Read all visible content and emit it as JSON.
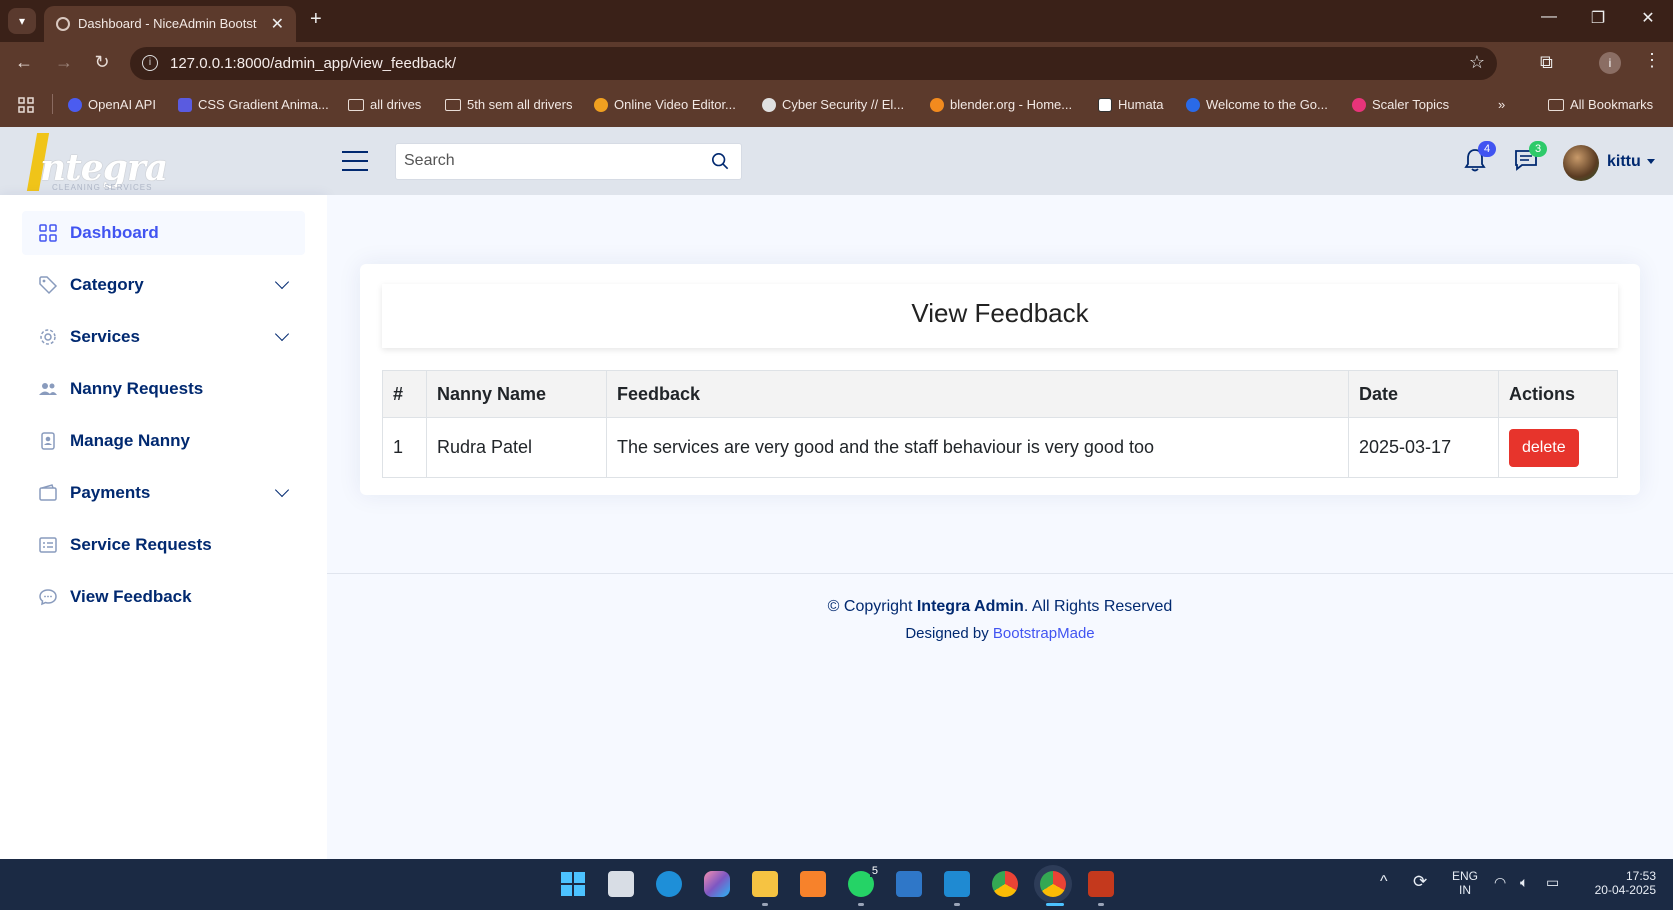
{
  "browser": {
    "tab_title": "Dashboard - NiceAdmin Bootst",
    "url": "127.0.0.1:8000/admin_app/view_feedback/",
    "bookmarks": [
      {
        "label": "OpenAI API",
        "color": "#4b5cf0"
      },
      {
        "label": "CSS Gradient Anima...",
        "color": "#5a5be0"
      },
      {
        "label": "all drives",
        "color": "folder"
      },
      {
        "label": "5th sem all drivers",
        "color": "folder"
      },
      {
        "label": "Online Video Editor...",
        "color": "#f0a020"
      },
      {
        "label": "Cyber Security // El...",
        "color": "#e0e0e0"
      },
      {
        "label": "blender.org - Home...",
        "color": "#f28a1e"
      },
      {
        "label": "Humata",
        "color": "#ffffff"
      },
      {
        "label": "Welcome to the Go...",
        "color": "#2a6ae8"
      },
      {
        "label": "Scaler Topics",
        "color": "#e8347a"
      }
    ],
    "all_bookmarks_label": "All Bookmarks"
  },
  "header": {
    "logo_text": "ntegra",
    "logo_sub": "CLEANING   SERVICES",
    "search_placeholder": "Search",
    "notifications_count": "4",
    "messages_count": "3",
    "user_name": "kittu",
    "colors": {
      "notif_badge": "#4154f1",
      "msg_badge": "#2eca6a"
    }
  },
  "sidebar": {
    "items": [
      {
        "label": "Dashboard",
        "icon": "grid-icon",
        "active": true
      },
      {
        "label": "Category",
        "icon": "tag-icon",
        "expandable": true
      },
      {
        "label": "Services",
        "icon": "gear-icon",
        "expandable": true
      },
      {
        "label": "Nanny Requests",
        "icon": "people-icon"
      },
      {
        "label": "Manage Nanny",
        "icon": "badge-icon"
      },
      {
        "label": "Payments",
        "icon": "wallet-icon",
        "expandable": true
      },
      {
        "label": "Service Requests",
        "icon": "list-card-icon"
      },
      {
        "label": "View Feedback",
        "icon": "chat-icon"
      }
    ]
  },
  "main": {
    "card_title": "View Feedback",
    "table": {
      "headers": [
        "#",
        "Nanny Name",
        "Feedback",
        "Date",
        "Actions"
      ],
      "rows": [
        {
          "num": "1",
          "name": "Rudra Patel",
          "feedback": "The services are very good and the staff behaviour is very good too",
          "date": "2025-03-17",
          "action": "delete"
        }
      ]
    },
    "footer": {
      "copyright_prefix": "© Copyright",
      "brand": "Integra Admin",
      "copyright_suffix": ". All Rights Reserved",
      "designed_prefix": "Designed by",
      "designed_link": "BootstrapMade"
    }
  },
  "taskbar": {
    "whatsapp_badge": "5",
    "lang_top": "ENG",
    "lang_bottom": "IN",
    "time": "17:53",
    "date": "20-04-2025"
  }
}
